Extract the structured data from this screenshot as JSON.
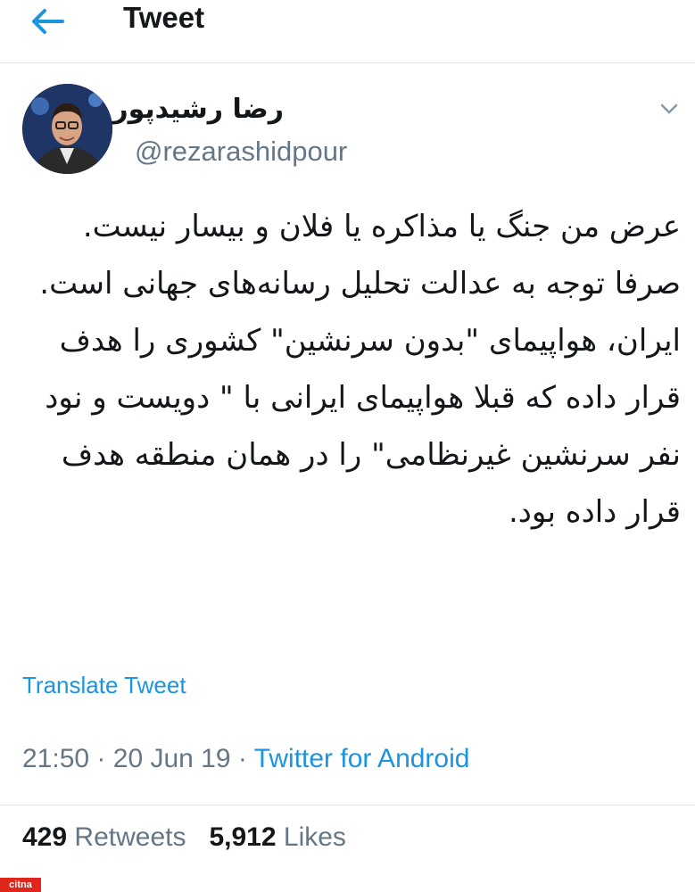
{
  "header": {
    "title": "Tweet"
  },
  "author": {
    "display_name": "رضا رشیدپور",
    "handle": "@rezarashidpour"
  },
  "tweet": {
    "text": "عرض من جنگ یا مذاکره یا فلان و بیسار نیست. صرفا توجه به عدالت تحلیل رسانه‌های جهانی است.\nایران، هواپیمای \"بدون سرنشین\" کشوری را هدف قرار داده که قبلا هواپیمای ایرانی با \" دویست و نود نفر سرنشین غیرنظامی\" را در همان منطقه هدف قرار داده بود."
  },
  "translate_label": "Translate Tweet",
  "meta": {
    "time": "21:50",
    "date": "20 Jun 19",
    "separator": "·",
    "source": "Twitter for Android"
  },
  "stats": {
    "retweets_count": "429",
    "retweets_label": "Retweets",
    "likes_count": "5,912",
    "likes_label": "Likes"
  },
  "watermark": "citna",
  "colors": {
    "link": "#1b95e0",
    "muted": "#657786",
    "text": "#14171a"
  }
}
